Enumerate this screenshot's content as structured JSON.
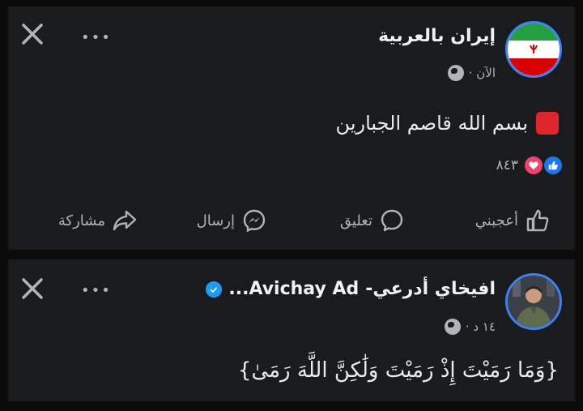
{
  "post1": {
    "page_name": "إيران بالعربية",
    "time": "الآن ·",
    "text": "بسم الله قاصم الجبارين",
    "reaction_count": "٨٤٣",
    "actions": {
      "like": "أعجبني",
      "comment": "تعليق",
      "send": "إرسال",
      "share": "مشاركة"
    },
    "icons": [
      "globe-icon",
      "like-reaction-icon",
      "love-reaction-icon",
      "more-icon",
      "close-icon"
    ]
  },
  "post2": {
    "name_ar": "افيخاي أدرعي-",
    "name_en": "...Avichay Ad",
    "time": "١٤ د ·",
    "text": "{وَمَا رَمَيْتَ إِذْ رَمَيْتَ وَلَٰكِنَّ اللَّهَ رَمَىٰ}"
  },
  "colors": {
    "background": "#1a1b1d",
    "accent": "#1877f2",
    "text": "#e9eaed",
    "muted": "#b0b3b8"
  }
}
